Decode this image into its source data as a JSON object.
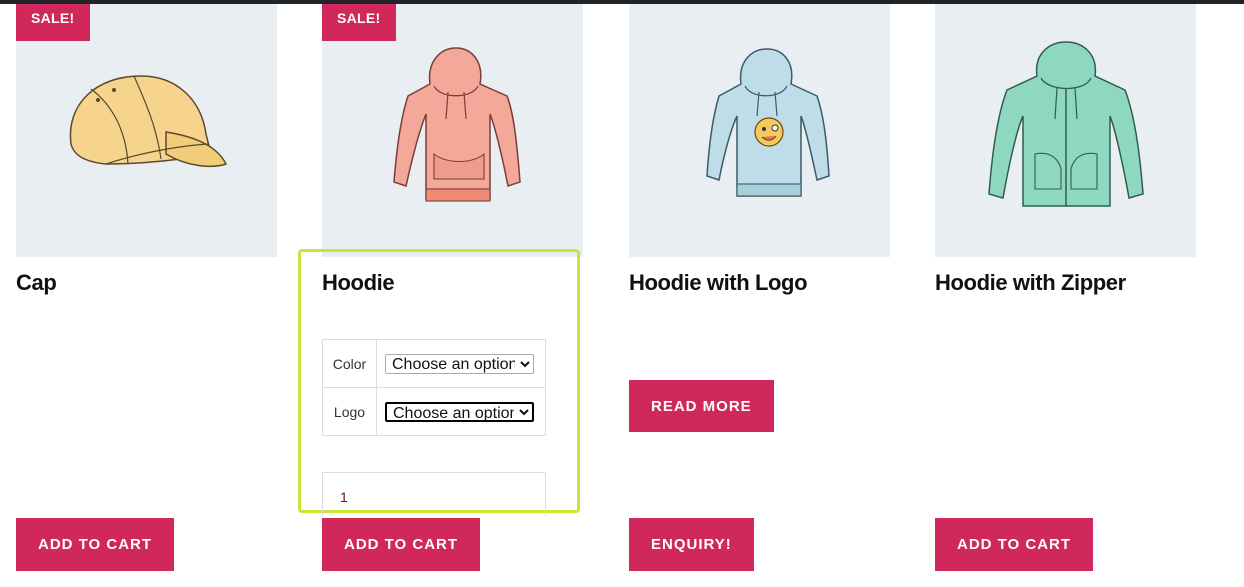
{
  "colors": {
    "accent": "#d0285a",
    "focus_outline": "#c7e63c",
    "thumb_bg": "#e9eef2"
  },
  "products": [
    {
      "name": "Cap",
      "sale_badge": "SALE!",
      "image_icon": "cap-icon",
      "button": "ADD TO CART"
    },
    {
      "name": "Hoodie",
      "sale_badge": "SALE!",
      "image_icon": "hoodie-icon",
      "button": "ADD TO CART",
      "variations": [
        {
          "label": "Color",
          "selected": "Choose an option"
        },
        {
          "label": "Logo",
          "selected": "Choose an option"
        }
      ],
      "quantity": "1"
    },
    {
      "name": "Hoodie with Logo",
      "image_icon": "hoodie-with-logo-icon",
      "read_more": "READ MORE",
      "button": "ENQUIRY!"
    },
    {
      "name": "Hoodie with Zipper",
      "image_icon": "hoodie-with-zipper-icon",
      "button": "ADD TO CART"
    }
  ]
}
